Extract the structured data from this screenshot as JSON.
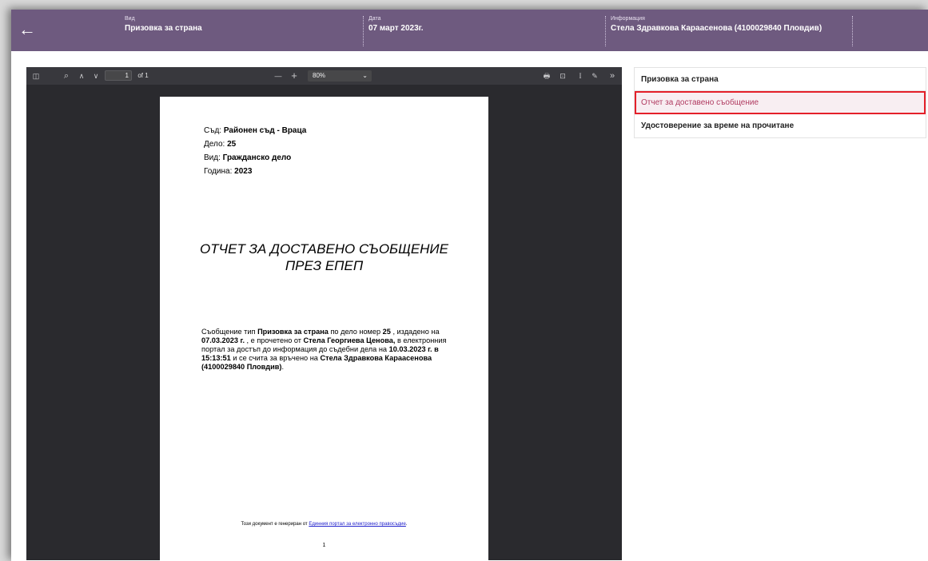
{
  "header": {
    "back_icon": "←",
    "type_label": "Вид",
    "type_value": "Призовка за страна",
    "date_label": "Дата",
    "date_value": "07 март 2023г.",
    "info_label": "Информация",
    "info_value": "Стела Здравкова Караасенова (4100029840 Пловдив)",
    "bg_color": "#6e5a7f"
  },
  "viewer": {
    "toolbar": {
      "sidebar_icon": "◫",
      "search_icon": "⌕",
      "prev_icon": "∧",
      "next_icon": "∨",
      "page_current": "1",
      "page_total": "of 1",
      "zoom_out_icon": "—",
      "zoom_in_icon": "+",
      "zoom_value": "80%",
      "zoom_chevron": "⌄",
      "print_icon": "🖶",
      "download_icon": "⊡",
      "text_cursor_icon": "I",
      "draw_icon": "✎",
      "more_icon": "»"
    },
    "page": {
      "court_label": "Съд:",
      "court_value": "Районен съд - Враца",
      "case_label": "Дело:",
      "case_value": "25",
      "kind_label": "Вид:",
      "kind_value": "Гражданско дело",
      "year_label": "Година:",
      "year_value": "2023",
      "title_line1": "ОТЧЕТ ЗА ДОСТАВЕНО СЪОБЩЕНИЕ",
      "title_line2": "ПРЕЗ ЕПЕП",
      "body": {
        "t1": "Съобщение тип ",
        "b1": "Призовка за страна",
        "t2": " по дело номер ",
        "b2": "25",
        "t3": " , издадено на ",
        "b3": "07.03.2023 г.",
        "t4": " , е прочетено от ",
        "b4": "Стела Георгиева Ценова,",
        "t5": " в електронния портал за достъп до информация до съдебни дела на ",
        "b5": "10.03.2023 г. в 15:13:51",
        "t6": " и се счита за връчено на ",
        "b6": "Стела Здравкова Караасенова (4100029840 Пловдив)",
        "t7": "."
      },
      "footer_text": "Този документ е генериран от ",
      "footer_link": "Единния портал за електронно правосъдие",
      "footer_end": ".",
      "page_number": "1"
    }
  },
  "documents": [
    {
      "label": "Призовка за страна",
      "active": false
    },
    {
      "label": "Отчет за доставено съобщение",
      "active": true
    },
    {
      "label": "Удостоверение за време на прочитане",
      "active": false
    }
  ],
  "colors": {
    "accent": "#6e5a7f",
    "active_text": "#b03a60",
    "active_border": "#e4202a"
  }
}
